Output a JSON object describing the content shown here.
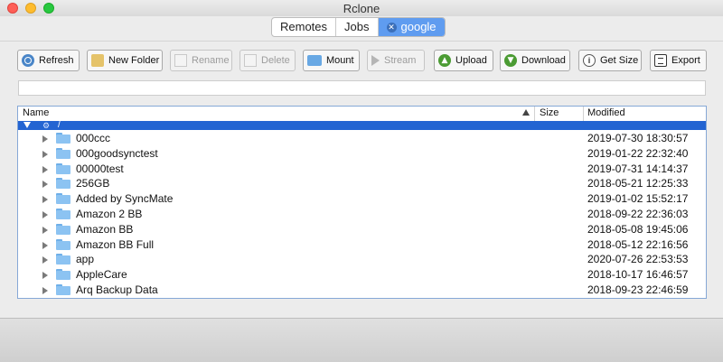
{
  "window": {
    "title": "Rclone"
  },
  "tabs": [
    {
      "label": "Remotes"
    },
    {
      "label": "Jobs"
    },
    {
      "label": "google",
      "close_icon": "close-circle-icon"
    }
  ],
  "toolbar": {
    "refresh": "Refresh",
    "new_folder": "New Folder",
    "rename": "Rename",
    "delete": "Delete",
    "mount": "Mount",
    "stream": "Stream",
    "upload": "Upload",
    "download": "Download",
    "get_size": "Get Size",
    "export": "Export"
  },
  "path": {
    "value": ""
  },
  "table": {
    "columns": {
      "name": "Name",
      "size": "Size",
      "modified": "Modified"
    },
    "root": {
      "name": "/"
    },
    "rows": [
      {
        "name": "000ccc",
        "size": "",
        "modified": "2019-07-30 18:30:57"
      },
      {
        "name": "000goodsynctest",
        "size": "",
        "modified": "2019-01-22 22:32:40"
      },
      {
        "name": "00000test",
        "size": "",
        "modified": "2019-07-31 14:14:37"
      },
      {
        "name": "256GB",
        "size": "",
        "modified": "2018-05-21 12:25:33"
      },
      {
        "name": "Added by SyncMate",
        "size": "",
        "modified": "2019-01-02 15:52:17"
      },
      {
        "name": "Amazon 2 BB",
        "size": "",
        "modified": "2018-09-22 22:36:03"
      },
      {
        "name": "Amazon BB",
        "size": "",
        "modified": "2018-05-08 19:45:06"
      },
      {
        "name": "Amazon BB Full",
        "size": "",
        "modified": "2018-05-12 22:16:56"
      },
      {
        "name": "app",
        "size": "",
        "modified": "2020-07-26 22:53:53"
      },
      {
        "name": "AppleCare",
        "size": "",
        "modified": "2018-10-17 16:46:57"
      },
      {
        "name": "Arq Backup Data",
        "size": "",
        "modified": "2018-09-23 22:46:59"
      }
    ]
  },
  "colors": {
    "accent": "#2364d2",
    "tab_active": "#5f9cf0",
    "folder": "#8cc3f2"
  }
}
